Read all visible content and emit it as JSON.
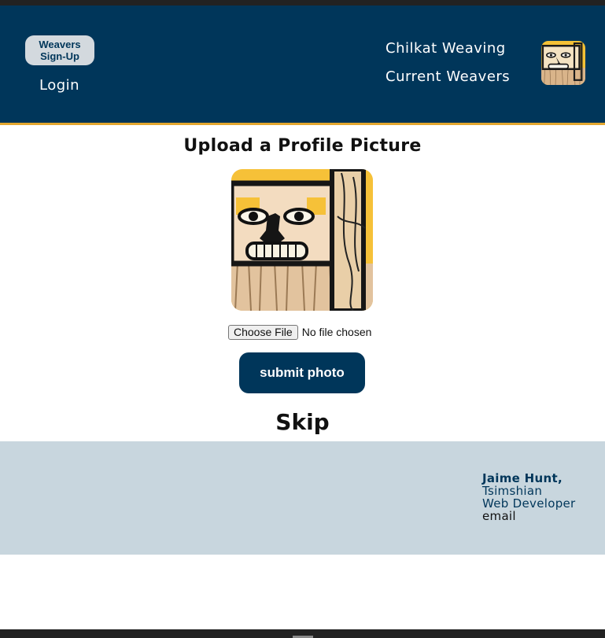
{
  "header": {
    "signup_label": "Weavers Sign-Up",
    "login_label": "Login",
    "nav": [
      "Chilkat Weaving",
      "Current Weavers"
    ],
    "logo_icon": "chilkat-face-logo-icon"
  },
  "main": {
    "title": "Upload a Profile Picture",
    "profile_image_icon": "chilkat-face-image",
    "file_button_label": "Choose File",
    "file_status": "No file chosen",
    "submit_label": "submit photo",
    "skip_label": "Skip"
  },
  "footer": {
    "name": "Jaime Hunt,",
    "nation": "Tsimshian",
    "role": "Web Developer",
    "email_label": "email"
  },
  "colors": {
    "navy": "#00365a",
    "gold_accent": "#e3a72f",
    "footer_bg": "#c8d6de"
  }
}
